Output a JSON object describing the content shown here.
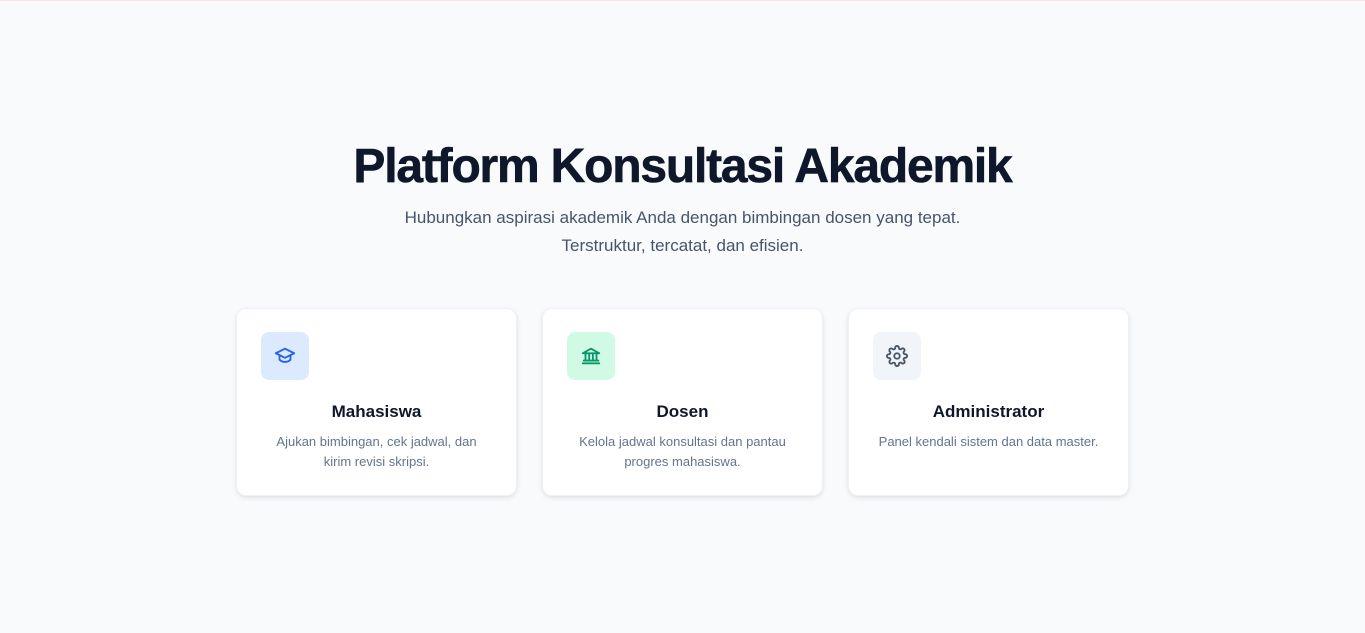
{
  "hero": {
    "title": "Platform Konsultasi Akademik",
    "subtitle_line1": "Hubungkan aspirasi akademik Anda dengan bimbingan dosen yang tepat.",
    "subtitle_line2": "Terstruktur, tercatat, dan efisien."
  },
  "roles": [
    {
      "title": "Mahasiswa",
      "description": "Ajukan bimbingan, cek jadwal, dan kirim revisi skripsi.",
      "icon": "graduation-cap-icon",
      "icon_color": "#2563eb",
      "icon_bg": "#dbeafe"
    },
    {
      "title": "Dosen",
      "description": "Kelola jadwal konsultasi dan pantau progres mahasiswa.",
      "icon": "university-building-icon",
      "icon_color": "#059669",
      "icon_bg": "#d1fae5"
    },
    {
      "title": "Administrator",
      "description": "Panel kendali sistem dan data master.",
      "icon": "gear-icon",
      "icon_color": "#475569",
      "icon_bg": "#f1f5f9"
    }
  ]
}
